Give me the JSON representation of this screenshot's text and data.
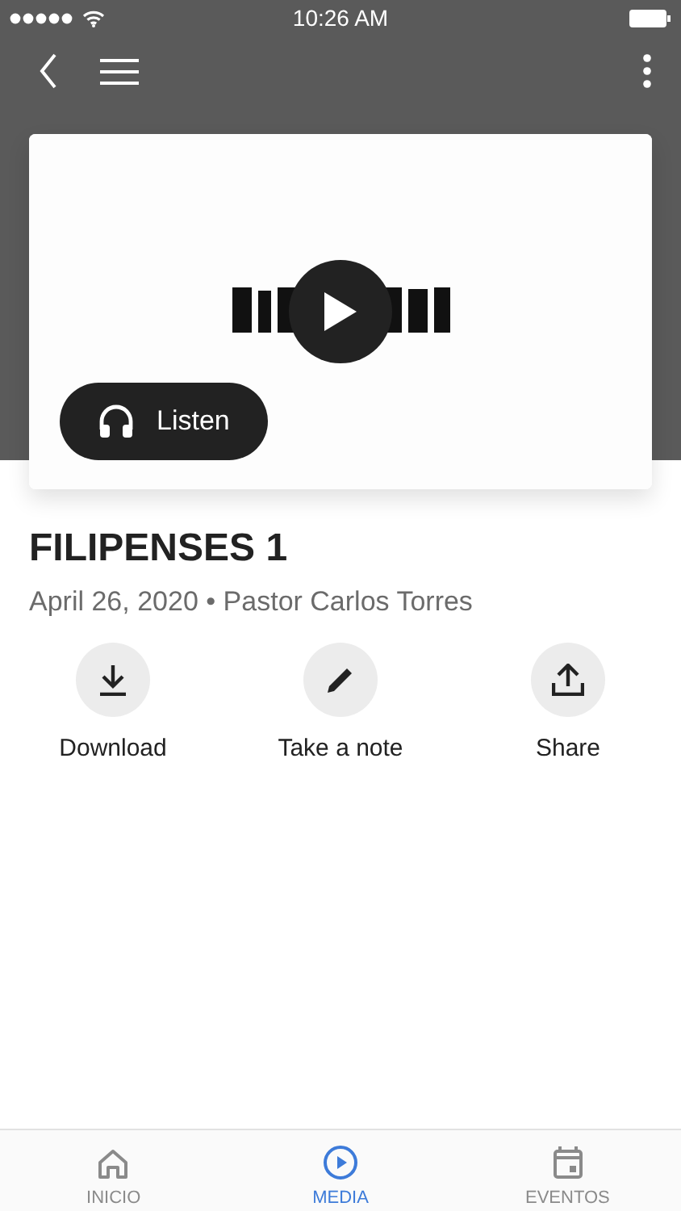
{
  "status_bar": {
    "time": "10:26 AM"
  },
  "media": {
    "listen_label": "Listen",
    "title": "FILIPENSES 1",
    "meta": "April 26, 2020 • Pastor Carlos Torres"
  },
  "actions": [
    {
      "kind": "download",
      "label": "Download"
    },
    {
      "kind": "note",
      "label": "Take a note"
    },
    {
      "kind": "share",
      "label": "Share"
    }
  ],
  "tabs": [
    {
      "kind": "home",
      "label": "INICIO",
      "selected": false
    },
    {
      "kind": "media",
      "label": "MEDIA",
      "selected": true
    },
    {
      "kind": "events",
      "label": "EVENTOS",
      "selected": false
    }
  ]
}
